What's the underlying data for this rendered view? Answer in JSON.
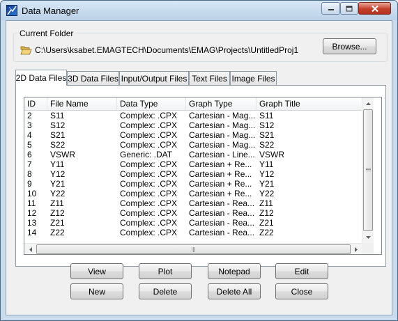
{
  "window": {
    "title": "Data Manager"
  },
  "folder": {
    "group_label": "Current Folder",
    "path": "C:\\Users\\ksabet.EMAGTECH\\Documents\\EMAG\\Projects\\UntitledProj1",
    "browse_label": "Browse..."
  },
  "tabs": [
    "2D Data Files",
    "3D Data Files",
    "Input/Output Files",
    "Text Files",
    "Image Files"
  ],
  "active_tab": "2D Data Files",
  "table": {
    "columns": [
      "ID",
      "File Name",
      "Data Type",
      "Graph Type",
      "Graph Title"
    ],
    "rows": [
      [
        "2",
        "S11",
        "Complex: .CPX",
        "Cartesian - Mag...",
        "S11"
      ],
      [
        "3",
        "S12",
        "Complex: .CPX",
        "Cartesian - Mag...",
        "S12"
      ],
      [
        "4",
        "S21",
        "Complex: .CPX",
        "Cartesian - Mag...",
        "S21"
      ],
      [
        "5",
        "S22",
        "Complex: .CPX",
        "Cartesian - Mag...",
        "S22"
      ],
      [
        "6",
        "VSWR",
        "Generic: .DAT",
        "Cartesian - Line...",
        "VSWR"
      ],
      [
        "7",
        "Y11",
        "Complex: .CPX",
        "Cartesian + Re...",
        "Y11"
      ],
      [
        "8",
        "Y12",
        "Complex: .CPX",
        "Cartesian + Re...",
        "Y12"
      ],
      [
        "9",
        "Y21",
        "Complex: .CPX",
        "Cartesian + Re...",
        "Y21"
      ],
      [
        "10",
        "Y22",
        "Complex: .CPX",
        "Cartesian + Re...",
        "Y22"
      ],
      [
        "11",
        "Z11",
        "Complex: .CPX",
        "Cartesian - Rea...",
        "Z11"
      ],
      [
        "12",
        "Z12",
        "Complex: .CPX",
        "Cartesian - Rea...",
        "Z12"
      ],
      [
        "13",
        "Z21",
        "Complex: .CPX",
        "Cartesian - Rea...",
        "Z21"
      ],
      [
        "14",
        "Z22",
        "Complex: .CPX",
        "Cartesian - Rea...",
        "Z22"
      ]
    ]
  },
  "buttons": {
    "view": "View",
    "plot": "Plot",
    "notepad": "Notepad",
    "edit": "Edit",
    "new": "New",
    "delete": "Delete",
    "delete_all": "Delete All",
    "close": "Close"
  },
  "icons": {
    "app": "app-logo-icon",
    "minimize": "minimize-icon",
    "maximize": "maximize-icon",
    "close": "close-icon",
    "folder": "open-folder-icon"
  },
  "colors": {
    "titlebar": "#c9dbed",
    "close_button": "#c4402c",
    "window_bg": "#f0f0f0"
  }
}
